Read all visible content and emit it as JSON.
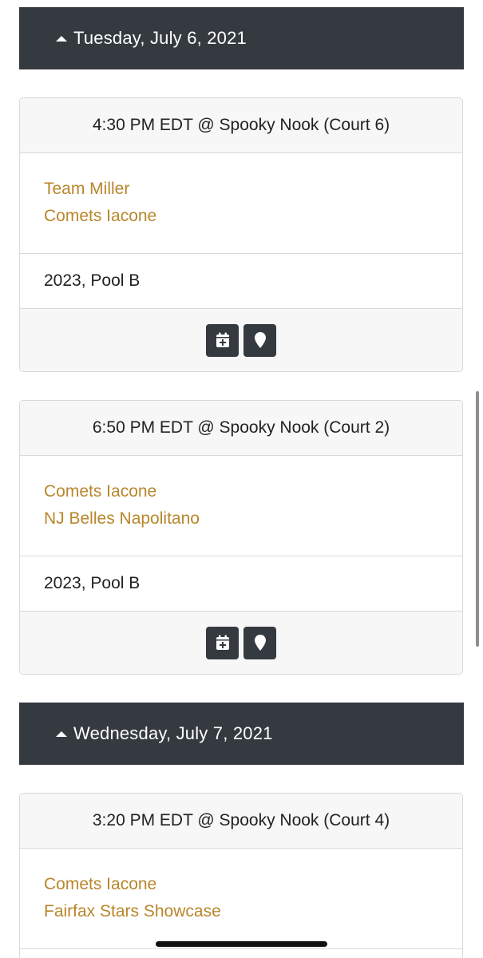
{
  "days": [
    {
      "label": "Tuesday, July 6, 2021",
      "games": [
        {
          "header": "4:30 PM EDT @ Spooky Nook (Court 6)",
          "team1": "Team Miller",
          "team2": "Comets Iacone",
          "pool": "2023, Pool B"
        },
        {
          "header": "6:50 PM EDT @ Spooky Nook (Court 2)",
          "team1": "Comets Iacone",
          "team2": "NJ Belles Napolitano",
          "pool": "2023, Pool B"
        }
      ]
    },
    {
      "label": "Wednesday, July 7, 2021",
      "games": [
        {
          "header": "3:20 PM EDT @ Spooky Nook (Court 4)",
          "team1": "Comets Iacone",
          "team2": "Fairfax Stars Showcase"
        }
      ]
    }
  ],
  "icons": {
    "add_calendar": "calendar-plus-icon",
    "map": "map-marker-icon",
    "collapse": "caret-up-icon"
  },
  "colors": {
    "header_bg": "#343a40",
    "link": "#b8862b",
    "card_bg": "#f7f7f7"
  }
}
